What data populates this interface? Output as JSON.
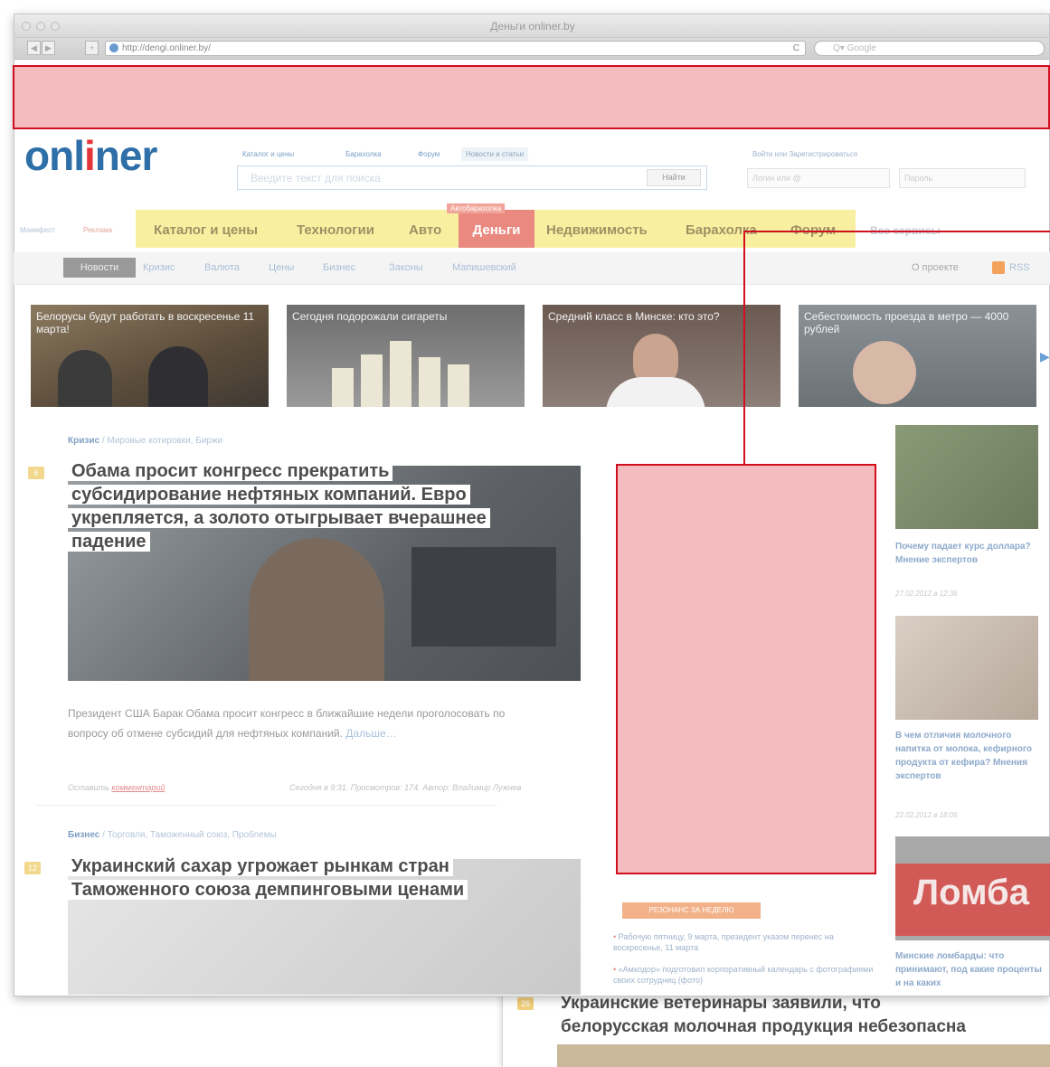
{
  "browser": {
    "window_title": "Деньги onliner.by",
    "url": "http://dengi.onliner.by/",
    "search_placeholder": "Q▾ Google",
    "nav_back": "◀",
    "nav_forward": "▶",
    "nav_add": "+",
    "reload": "C"
  },
  "header": {
    "logo_text_1": "onl",
    "logo_text_i": "i",
    "logo_text_2": "ner",
    "top_links": [
      "Каталог и цены",
      "Барахолка",
      "Форум",
      "Новости и статьи"
    ],
    "search_placeholder": "Введите текст для поиска",
    "search_button": "Найти",
    "login_text": "Войти или Зарегистрироваться",
    "login_placeholder": "Логин или @",
    "password_placeholder": "Пароль"
  },
  "mainnav": {
    "manifest": "Манифест",
    "ads": "Реклама",
    "items": [
      "Каталог и цены",
      "Технологии",
      "Авто",
      "Деньги",
      "Недвижимость",
      "Барахолка",
      "Форум"
    ],
    "badge": "Автобарахолка",
    "all_services": "Все сервисы"
  },
  "subnav": {
    "items": [
      "Новости",
      "Кризис",
      "Валюта",
      "Цены",
      "Бизнес",
      "Законы",
      "Мапишевский"
    ],
    "about": "О проекте",
    "rss": "RSS"
  },
  "thumbs": [
    {
      "caption": "Белорусы будут работать в воскресенье 11 марта!"
    },
    {
      "caption": "Сегодня подорожали сигареты"
    },
    {
      "caption": "Средний класс в Минске: кто это?"
    },
    {
      "caption": "Себестоимость проезда в метро — 4000 рублей"
    }
  ],
  "articles": [
    {
      "category": "Кризис",
      "tags": "/ Мировые котировки, Биржи",
      "count": "6",
      "headline": [
        "Обама просит конгресс прекратить",
        "субсидирование нефтяных компаний. Евро",
        "укрепляется, а золото отыгрывает вчерашнее",
        "падение"
      ],
      "teaser": "Президент США Барак Обама просит конгресс в ближайшие недели проголосовать по вопросу об отмене субсидий для нефтяных компаний.",
      "more": "Дальше…",
      "comment_prefix": "Оставить",
      "comment_link": "комментарий",
      "meta": "Сегодня в 9:31. Просмотров: 174. Автор: Владимир Лужнев"
    },
    {
      "category": "Бизнес",
      "tags": "/ Торговля, Таможенный союз, Проблемы",
      "count": "12",
      "headline": [
        "Украинский сахар угрожает рынкам стран",
        "Таможенного союза демпинговыми ценами"
      ]
    }
  ],
  "sidebar": [
    {
      "caption": "Почему падает курс доллара? Мнение экспертов",
      "date": "27.02.2012 в 12:36"
    },
    {
      "caption": "В чем отличия молочного напитка от молока, кефирного продукта от кефира? Мнения экспертов",
      "date": "22.02.2012 в 18:06"
    },
    {
      "caption": "Минские ломбарды: что принимают, под какие проценты и на каких",
      "date": "",
      "image_text": "Ломба"
    }
  ],
  "resonance": {
    "label": "РЕЗОНАНС ЗА НЕДЕЛЮ",
    "items": [
      "Рабочую пятницу, 9 марта, президент указом перенес на воскресенье, 11 марта",
      "«Амкодор» подготовил корпоративный календарь с фотографиями своих сотрудниц (фото)"
    ]
  },
  "window2": {
    "count": "26",
    "headline": [
      "Украинские ветеринары заявили, что",
      "белорусская молочная продукция небезопасна"
    ]
  },
  "colors": {
    "accent_red": "#d10f1f",
    "logo_blue": "#2f6fa8",
    "nav_yellow": "#f8f0a0"
  }
}
